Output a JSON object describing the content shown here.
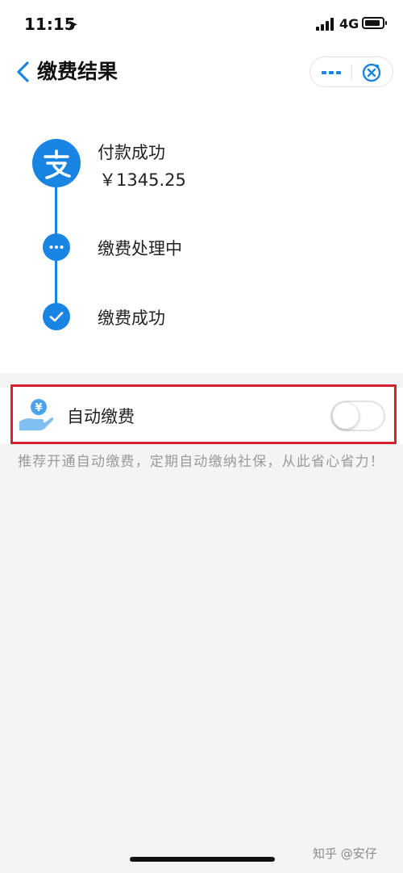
{
  "status_bar": {
    "time": "11:15",
    "location_icon": "location-arrow-icon",
    "network": "4G"
  },
  "nav": {
    "back_icon": "chevron-left-icon",
    "title": "缴费结果",
    "more_icon": "more-dots-icon",
    "close_icon": "close-circle-icon"
  },
  "timeline": {
    "steps": [
      {
        "title": "付款成功",
        "amount": "￥1345.25",
        "icon": "alipay-icon"
      },
      {
        "title": "缴费处理中",
        "icon": "ellipsis-dot-icon"
      },
      {
        "title": "缴费成功",
        "icon": "check-icon"
      }
    ]
  },
  "autopay": {
    "icon": "hand-coin-icon",
    "coin_symbol": "¥",
    "label": "自动缴费",
    "enabled": false,
    "hint": "推荐开通自动缴费，定期自动缴纳社保，从此省心省力！"
  },
  "watermark": "知乎 @安仔",
  "colors": {
    "accent": "#1a84e3",
    "highlight_border": "#d7212f",
    "background": "#f4f4f4",
    "hint_text": "#9a9a9a"
  }
}
